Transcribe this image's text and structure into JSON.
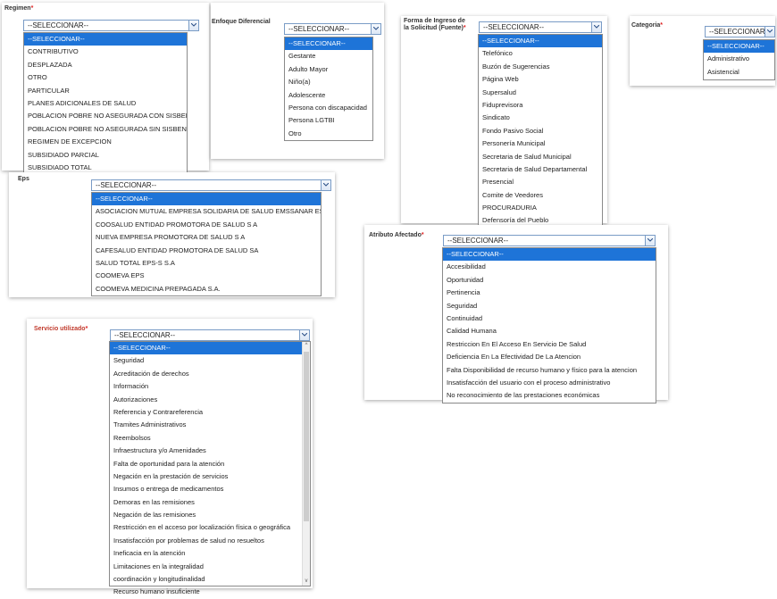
{
  "regimen": {
    "label": "Regimen",
    "required": "*",
    "selected": "--SELECCIONAR--",
    "options": [
      "--SELECCIONAR--",
      "CONTRIBUTIVO",
      "DESPLAZADA",
      "OTRO",
      "PARTICULAR",
      "PLANES ADICIONALES DE SALUD",
      "POBLACION POBRE NO ASEGURADA CON SISBEN",
      "POBLACION POBRE NO ASEGURADA SIN SISBEN",
      "REGIMEN DE EXCEPCION",
      "SUBSIDIADO PARCIAL",
      "SUBSIDIADO TOTAL"
    ]
  },
  "enfoque": {
    "label": "Enfoque Diferencial",
    "selected": "--SELECCIONAR--",
    "options": [
      "--SELECCIONAR--",
      "Gestante",
      "Adulto Mayor",
      "Niño(a)",
      "Adolescente",
      "Persona con discapacidad",
      "Persona LGTBI",
      "Otro"
    ]
  },
  "forma": {
    "label_line1": "Forma de Ingreso de",
    "label_line2": "la Solicitud (Fuente)",
    "required": "*",
    "selected": "--SELECCIONAR--",
    "options": [
      "--SELECCIONAR--",
      "Telefónico",
      "Buzón de Sugerencias",
      "Página Web",
      "Supersalud",
      "Fiduprevisora",
      "Sindicato",
      "Fondo Pasivo Social",
      "Personería Municipal",
      "Secretaria de Salud Municipal",
      "Secretaria de Salud Departamental",
      "Presencial",
      "Comite de Veedores",
      "PROCURADURIA",
      "Defensoría del Pueblo"
    ]
  },
  "categoria": {
    "label": "Categoria",
    "required": "*",
    "selected": "--SELECCIONAR--",
    "options": [
      "--SELECCIONAR--",
      "Administrativo",
      "Asistencial"
    ]
  },
  "eps": {
    "label": "Eps",
    "selected": "--SELECCIONAR--",
    "options": [
      "--SELECCIONAR--",
      "ASOCIACION MUTUAL EMPRESA SOLIDARIA DE SALUD EMSSANAR ESS",
      "COOSALUD ENTIDAD PROMOTORA DE SALUD S A",
      "NUEVA EMPRESA PROMOTORA DE SALUD S A",
      "CAFESALUD ENTIDAD PROMOTORA DE SALUD SA",
      "SALUD TOTAL EPS-S S.A",
      "COOMEVA EPS",
      "COOMEVA MEDICINA PREPAGADA S.A."
    ]
  },
  "atributo": {
    "label": "Atributo Afectado",
    "required": "*",
    "selected": "--SELECCIONAR--",
    "options": [
      "--SELECCIONAR--",
      "Accesibilidad",
      "Oportunidad",
      "Pertinencia",
      "Seguridad",
      "Continuidad",
      "Calidad Humana",
      "Restriccion En El Acceso En Servicio De Salud",
      "Deficiencia En La Efectividad De La Atencion",
      "Falta Disponibilidad de recurso humano y físico para la atencion",
      "Insatisfacción del usuario con el proceso administrativo",
      "No reconocimiento de las prestaciones económicas"
    ]
  },
  "servicio": {
    "label": "Servicio utilizado",
    "required": "*",
    "selected": "--SELECCIONAR--",
    "options": [
      "--SELECCIONAR--",
      "Seguridad",
      "Acreditación de derechos",
      "Información",
      "Autorizaciones",
      "Referencia y Contrareferencia",
      "Tramites Administrativos",
      "Reembolsos",
      "Infraestructura y/o Amenidades",
      "Falta de oportunidad para la atención",
      "Negación en la prestación de servicios",
      "Insumos o entrega de medicamentos",
      "Demoras en las remisiones",
      "Negación de las remisiones",
      "Restricción en el acceso por localización física o geográfica",
      "Insatisfacción por problemas de salud no resueltos",
      "Ineficacia en la atención",
      "Limitaciones en la integralidad",
      "coordinación y longitudinalidad",
      "Recurso humano insuficiente"
    ],
    "scroll_up": "^",
    "scroll_down": "v"
  },
  "colors": {
    "highlight": "#1e74d8",
    "required_label": "#c0392b"
  },
  "icons": {
    "dropdown": "chevron-down-icon"
  }
}
